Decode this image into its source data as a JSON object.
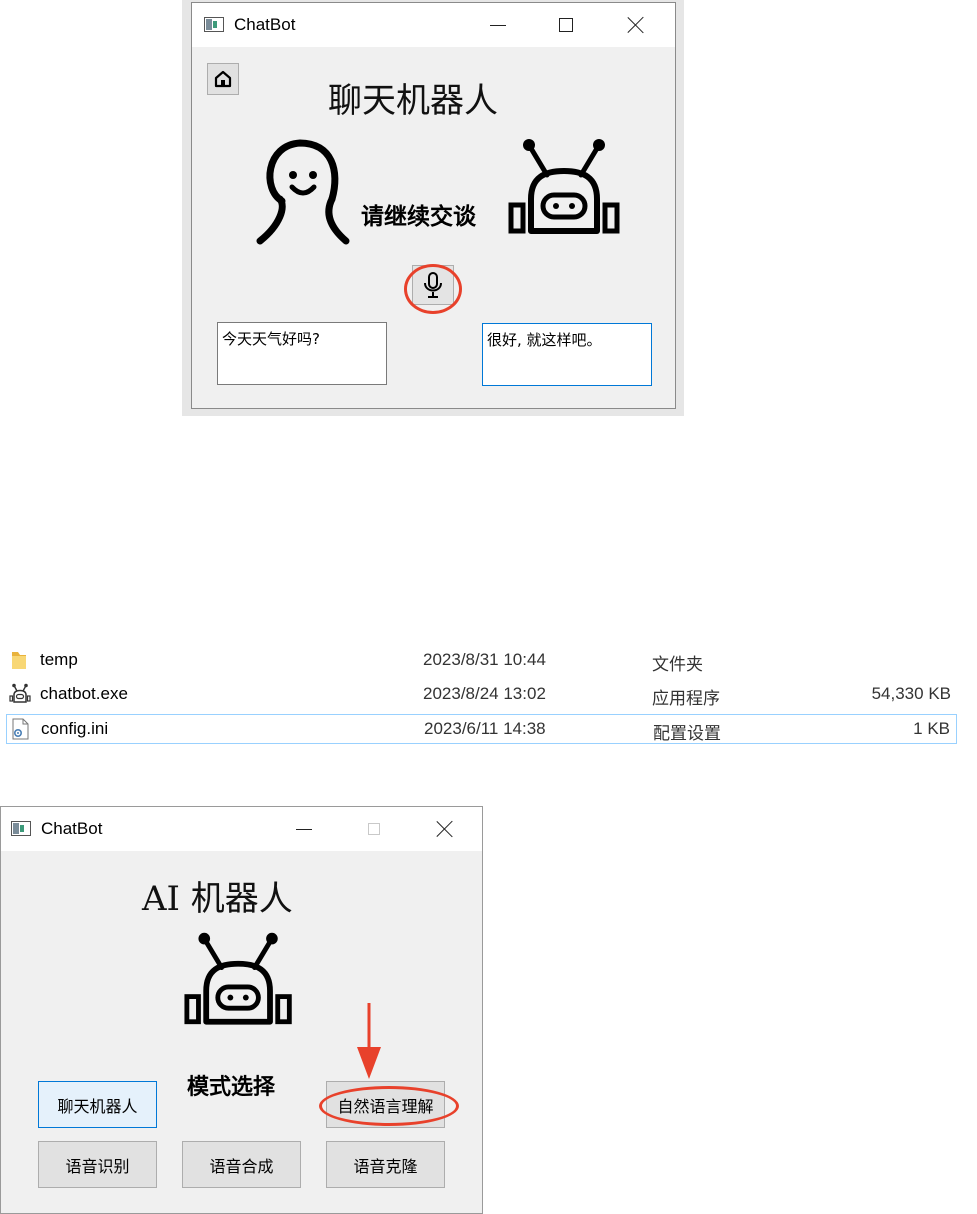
{
  "window1": {
    "title": "ChatBot",
    "heading": "聊天机器人",
    "status": "请继续交谈",
    "user_text": "今天天气好吗?",
    "bot_text": "很好, 就这样吧。"
  },
  "explorer": {
    "rows": [
      {
        "name": "temp",
        "date": "2023/8/31 10:44",
        "type": "文件夹",
        "size": "",
        "icon": "folder-icon"
      },
      {
        "name": "chatbot.exe",
        "date": "2023/8/24 13:02",
        "type": "应用程序",
        "size": "54,330 KB",
        "icon": "robot-app-icon"
      },
      {
        "name": "config.ini",
        "date": "2023/6/11 14:38",
        "type": "配置设置",
        "size": "1 KB",
        "icon": "config-file-icon"
      }
    ]
  },
  "window2": {
    "title": "ChatBot",
    "heading": "AI 机器人",
    "mode_label": "模式选择",
    "buttons": {
      "chatbot": "聊天机器人",
      "nlu": "自然语言理解",
      "asr": "语音识别",
      "tts": "语音合成",
      "clone": "语音克隆"
    }
  },
  "colors": {
    "annotation_red": "#e8412b",
    "focus_blue": "#0078d7",
    "window_bg": "#f0f0f0"
  }
}
